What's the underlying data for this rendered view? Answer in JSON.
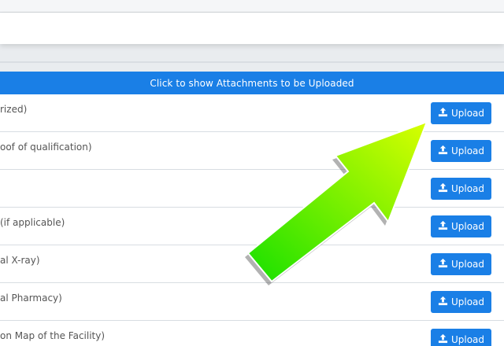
{
  "attachments_header": "Click to show Attachments to be Uploaded",
  "upload_label": "Upload",
  "rows": [
    {
      "label": "rized)"
    },
    {
      "label": "oof of qualification)"
    },
    {
      "label": ""
    },
    {
      "label": "(if applicable)"
    },
    {
      "label": "al X-ray)"
    },
    {
      "label": "al Pharmacy)"
    },
    {
      "label": "on Map of the Facility)"
    }
  ],
  "colors": {
    "accent": "#1a7fe6",
    "arrow_gradient_start": "#17e000",
    "arrow_gradient_end": "#d9ff00"
  },
  "icons": {
    "upload": "upload-icon",
    "annotation": "green-arrow"
  }
}
